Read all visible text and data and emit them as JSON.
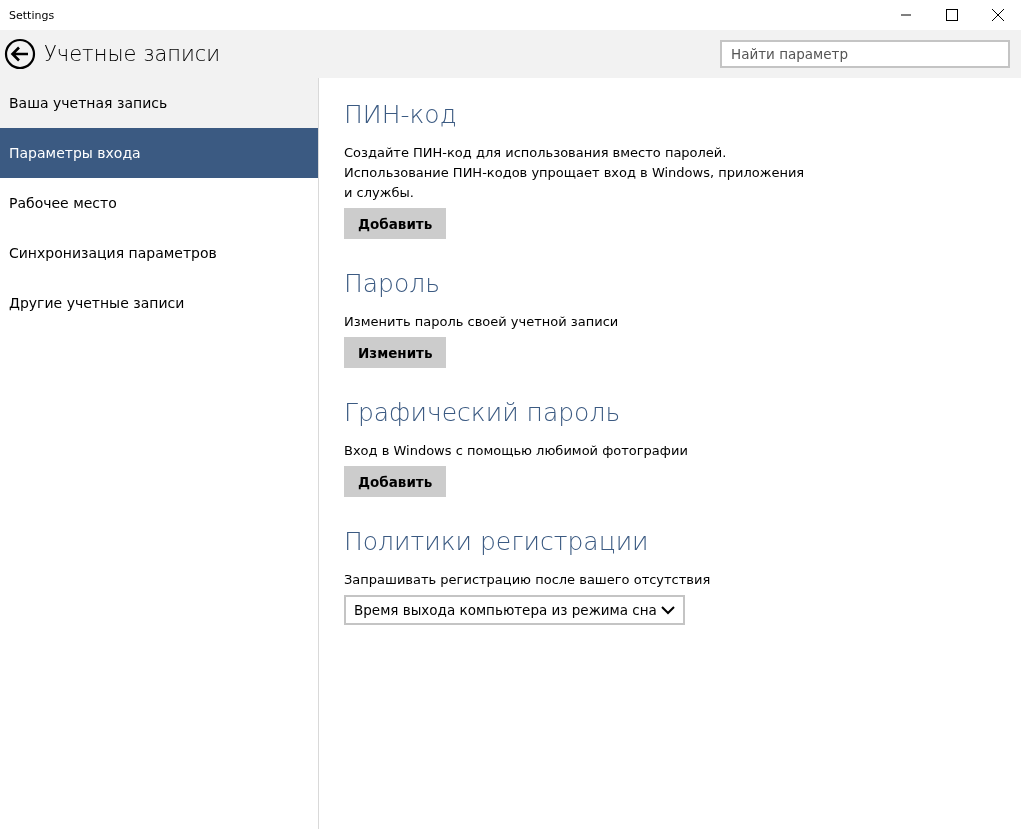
{
  "window": {
    "title": "Settings"
  },
  "header": {
    "title": "Учетные записи",
    "search": {
      "placeholder": "Найти параметр"
    }
  },
  "sidebar": {
    "items": [
      {
        "label": "Ваша учетная запись",
        "selected": false,
        "hovered": true
      },
      {
        "label": "Параметры входа",
        "selected": true,
        "hovered": false
      },
      {
        "label": "Рабочее место",
        "selected": false,
        "hovered": false
      },
      {
        "label": "Синхронизация параметров",
        "selected": false,
        "hovered": false
      },
      {
        "label": "Другие учетные записи",
        "selected": false,
        "hovered": false
      }
    ]
  },
  "sections": [
    {
      "kind": "button",
      "title": "ПИН-код",
      "text": "Создайте ПИН-код для использования вместо паролей. Использование ПИН-кодов упрощает вход в Windows, приложения и службы.",
      "button": "Добавить"
    },
    {
      "kind": "button",
      "title": "Пароль",
      "text": "Изменить пароль своей учетной записи",
      "button": "Изменить"
    },
    {
      "kind": "button",
      "title": "Графический пароль",
      "text": "Вход в Windows с помощью любимой фотографии",
      "button": "Добавить"
    },
    {
      "kind": "dropdown",
      "title": "Политики регистрации",
      "text": "Запрашивать регистрацию после вашего отсутствия",
      "value": "Время выхода компьютера из режима сна"
    }
  ]
}
